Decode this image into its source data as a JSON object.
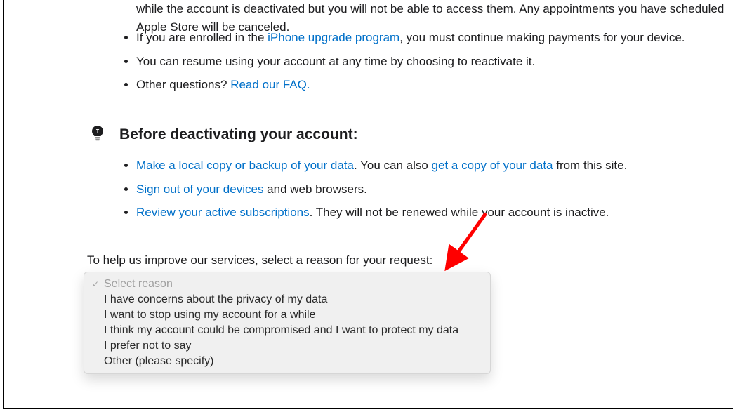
{
  "partial_top": {
    "prefix_cut": "while the account is deactivated but you will not be able to access them. Any appointments you have scheduled",
    "line2": "Apple Store will be canceled."
  },
  "bullets1": {
    "enroll_prefix": "If you are enrolled in the ",
    "upgrade_link": "iPhone upgrade program",
    "enroll_suffix": ", you must continue making payments for your device.",
    "resume": "You can resume using your account at any time by choosing to reactivate it.",
    "other_q_prefix": "Other questions? ",
    "faq_link": "Read our FAQ."
  },
  "heading": "Before deactivating your account:",
  "bullets2": {
    "backup_link": "Make a local copy or backup of your data",
    "backup_mid": ". You can also ",
    "getcopy_link": "get a copy of your data",
    "backup_suffix": " from this site.",
    "signout_link": "Sign out of your devices",
    "signout_suffix": " and web browsers.",
    "subs_link": "Review your active subscriptions",
    "subs_suffix": ". They will not be renewed while your account is inactive."
  },
  "prompt_text": "To help us improve our services, select a reason for your request:",
  "dropdown": {
    "placeholder": "Select reason",
    "options": [
      "I have concerns about the privacy of my data",
      "I want to stop using my account for a while",
      "I think my account could be compromised and I want to protect my data",
      "I prefer not to say",
      "Other (please specify)"
    ]
  }
}
